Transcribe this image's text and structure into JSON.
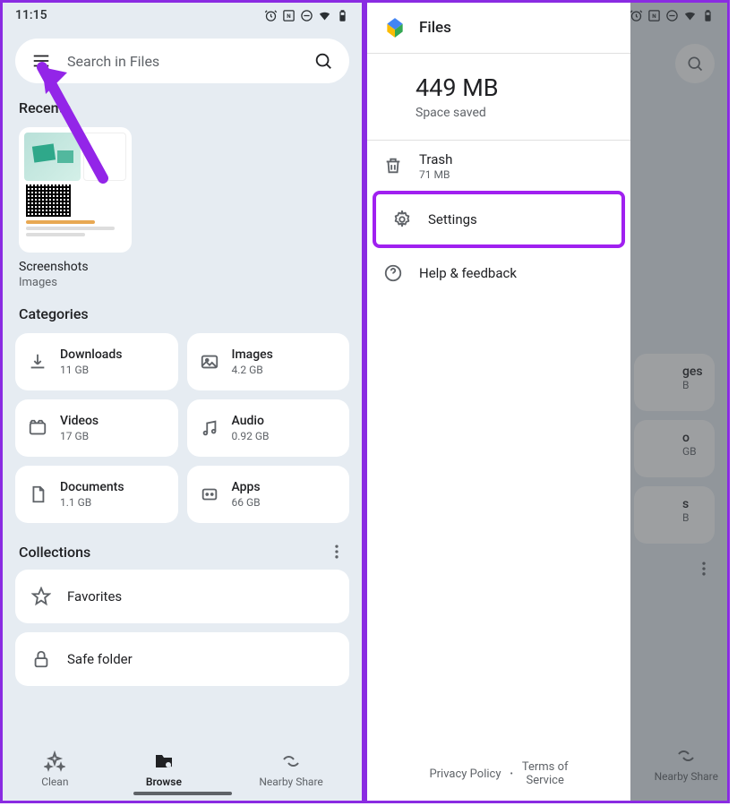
{
  "status": {
    "time": "11:15"
  },
  "search": {
    "placeholder": "Search in Files"
  },
  "recent": {
    "title": "Recents",
    "item_name": "Screenshots",
    "item_type": "Images"
  },
  "categories": {
    "title": "Categories",
    "items": [
      {
        "name": "Downloads",
        "size": "11 GB"
      },
      {
        "name": "Images",
        "size": "4.2 GB"
      },
      {
        "name": "Videos",
        "size": "17 GB"
      },
      {
        "name": "Audio",
        "size": "0.92 GB"
      },
      {
        "name": "Documents",
        "size": "1.1 GB"
      },
      {
        "name": "Apps",
        "size": "66 GB"
      }
    ]
  },
  "collections": {
    "title": "Collections",
    "items": [
      {
        "label": "Favorites"
      },
      {
        "label": "Safe folder"
      }
    ]
  },
  "nav": {
    "items": [
      {
        "label": "Clean"
      },
      {
        "label": "Browse"
      },
      {
        "label": "Nearby Share"
      }
    ]
  },
  "drawer": {
    "app": "Files",
    "space_value": "449 MB",
    "space_label": "Space saved",
    "trash_label": "Trash",
    "trash_size": "71 MB",
    "settings_label": "Settings",
    "help_label": "Help & feedback",
    "privacy": "Privacy Policy",
    "tos1": "Terms of",
    "tos2": "Service"
  },
  "bg_hints": {
    "c1a": "ges",
    "c1b": "B",
    "c2a": "o",
    "c2b": "GB",
    "c3a": "s",
    "c3b": "B",
    "nav": "Nearby Share"
  }
}
